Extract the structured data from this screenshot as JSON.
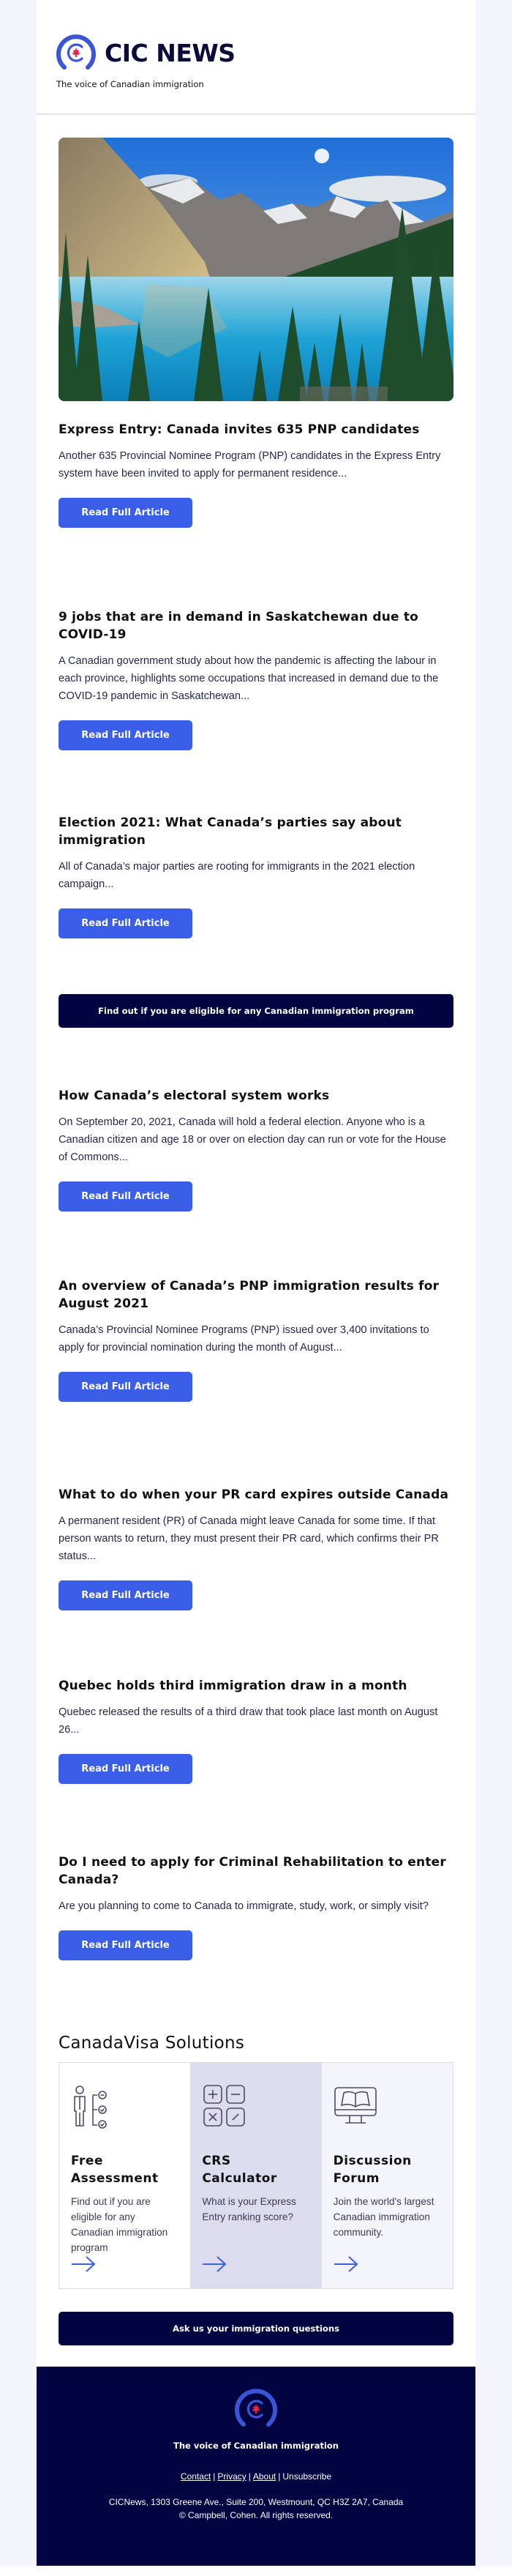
{
  "header": {
    "brand": "CIC NEWS",
    "tagline": "The voice of Canadian immigration"
  },
  "colors": {
    "navy": "#020341",
    "button_blue": "#3a5ee8",
    "maple_red": "#e8244a",
    "page_bg": "#f4f4fd"
  },
  "hero": {
    "icon": "landscape-photo",
    "description": "Mountain lake with turquoise water and evergreen trees"
  },
  "articles": [
    {
      "title": "Express Entry: Canada invites 635 PNP candidates",
      "summary": "Another 635 Provincial Nominee Program (PNP) candidates in the Express Entry system have been invited to apply for permanent residence...",
      "button": "Read Full Article"
    },
    {
      "title": "9 jobs that are in demand in Saskatchewan due to COVID-19",
      "summary": "A Canadian government study about how the pandemic is affecting the labour in each province, highlights some occupations that increased in demand due to the COVID-19 pandemic in Saskatchewan...",
      "button": "Read Full Article"
    },
    {
      "title": "Election 2021: What Canada’s parties say about immigration",
      "summary": "All of Canada’s major parties are rooting for immigrants in the 2021 election campaign...",
      "button": "Read Full Article"
    },
    {
      "title": "How Canada’s electoral system works",
      "summary": "On September 20, 2021, Canada will hold a federal election. Anyone who is a Canadian citizen and age 18 or over on election day can run or vote for the House of Commons...",
      "button": "Read Full Article"
    },
    {
      "title": "An overview of Canada’s PNP immigration results for August 2021",
      "summary": "Canada’s Provincial Nominee Programs (PNP) issued over 3,400 invitations to apply for provincial nomination during the month of August...",
      "button": "Read Full Article"
    },
    {
      "title": "What to do when your PR card expires outside Canada",
      "summary": "A permanent resident (PR) of Canada might leave Canada for some time. If that person wants to return, they must present their PR card, which confirms their PR status...",
      "button": "Read Full Article"
    },
    {
      "title": "Quebec holds third immigration draw in a month",
      "summary": "Quebec released the results of a third draw that took place last month on August 26...",
      "button": "Read Full Article"
    },
    {
      "title": "Do I need to apply for Criminal Rehabilitation to enter Canada?",
      "summary": "Are you planning to come to Canada to immigrate, study, work, or simply visit?",
      "button": "Read Full Article"
    }
  ],
  "eligibility_cta": "Find out if you are eligible for any Canadian immigration program",
  "solutions": {
    "title": "CanadaVisa Solutions",
    "cards": [
      {
        "icon": "assessment-checklist-icon",
        "title": "Free Assessment",
        "text": "Find out if you are eligible for any Canadian immigration program",
        "arrow": "arrow-right-icon"
      },
      {
        "icon": "calculator-icon",
        "title": "CRS Calculator",
        "text": "What is your Express Entry ranking score?",
        "arrow": "arrow-right-icon"
      },
      {
        "icon": "forum-monitor-book-icon",
        "title": "Discussion Forum",
        "text": "Join the world's largest Canadian immigration community.",
        "arrow": "arrow-right-icon"
      }
    ]
  },
  "questions_cta": "Ask us your immigration questions",
  "footer": {
    "tagline": "The voice of Canadian immigration",
    "links": [
      "Contact",
      "Privacy",
      "About",
      "Unsubscribe"
    ],
    "separator": "|",
    "address": "CICNews, 1303 Greene Ave., Suite 200, Westmount, QC H3Z 2A7, Canada",
    "copyright": "© Campbell, Cohen. All rights reserved."
  }
}
